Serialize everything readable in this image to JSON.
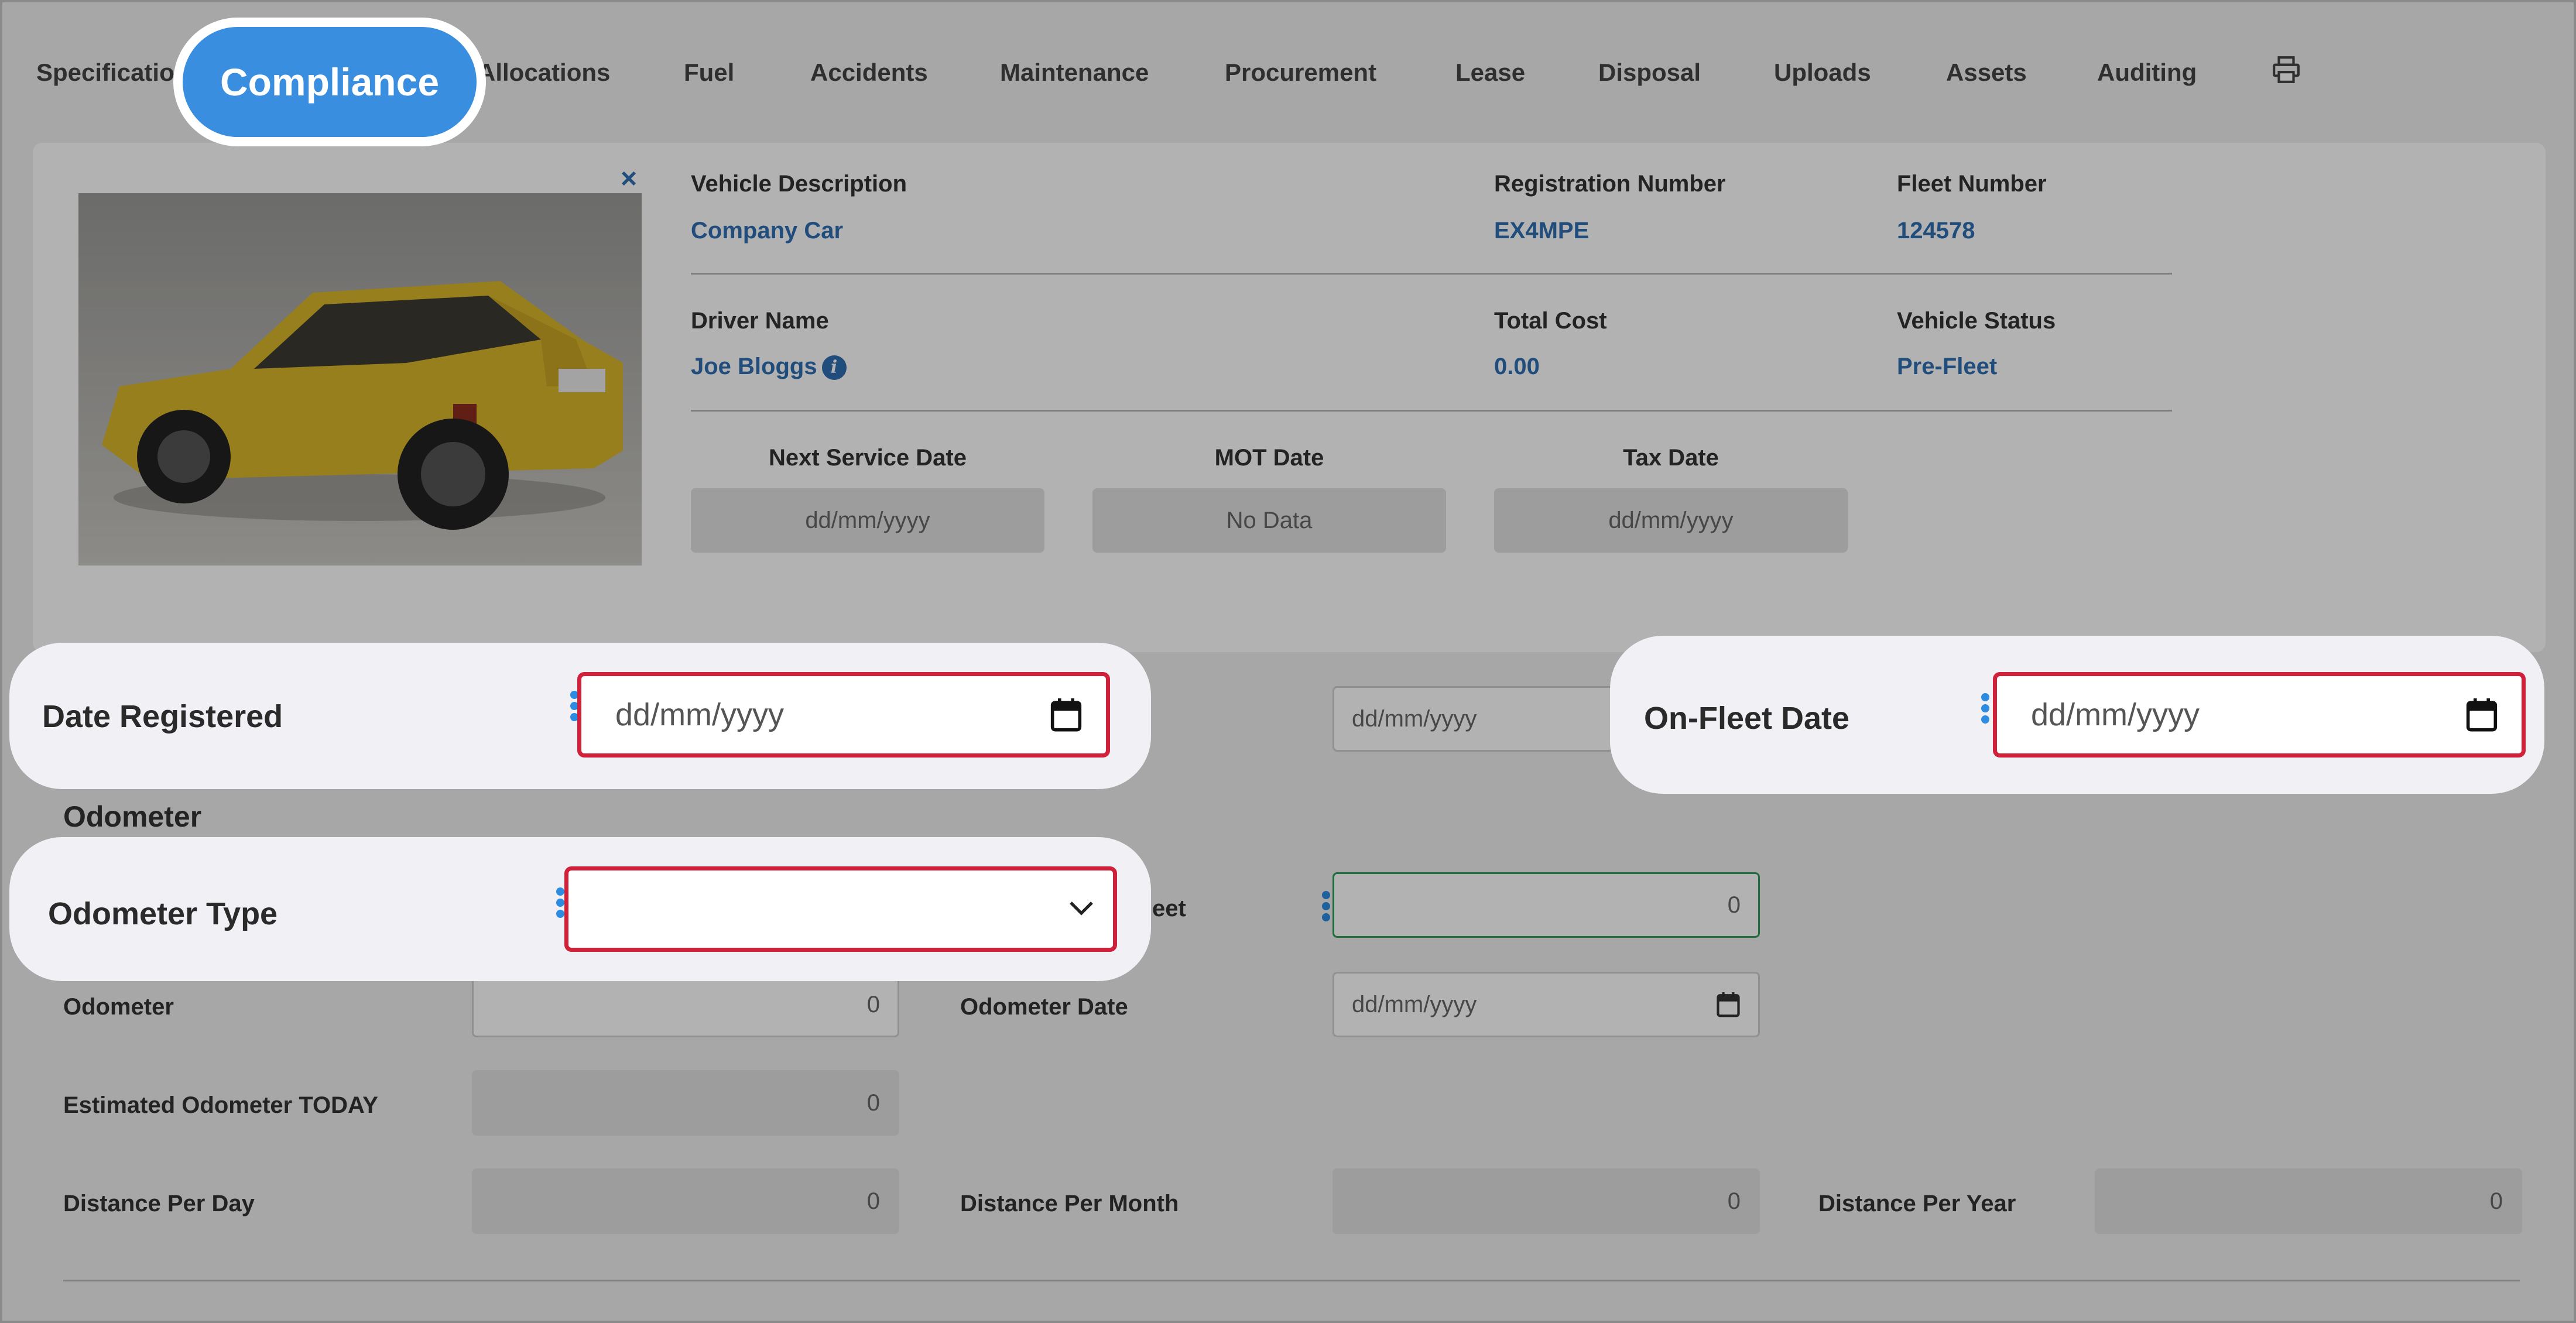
{
  "tabs": [
    {
      "label": "Specifications"
    },
    {
      "label": "Compliance"
    },
    {
      "label": "Allocations"
    },
    {
      "label": "Fuel"
    },
    {
      "label": "Accidents"
    },
    {
      "label": "Maintenance"
    },
    {
      "label": "Procurement"
    },
    {
      "label": "Lease"
    },
    {
      "label": "Disposal"
    },
    {
      "label": "Uploads"
    },
    {
      "label": "Assets"
    },
    {
      "label": "Auditing"
    }
  ],
  "active_tab": "Compliance",
  "toolbar": {
    "print_icon": "print-icon"
  },
  "vehicle": {
    "description_label": "Vehicle Description",
    "description_value": "Company Car",
    "registration_label": "Registration Number",
    "registration_value": "EX4MPE",
    "fleet_label": "Fleet Number",
    "fleet_value": "124578",
    "driver_label": "Driver Name",
    "driver_value": "Joe Bloggs",
    "cost_label": "Total Cost",
    "cost_value": "0.00",
    "status_label": "Vehicle Status",
    "status_value": "Pre-Fleet",
    "close_symbol": "×"
  },
  "dates": {
    "service_label": "Next Service Date",
    "service_value": "dd/mm/yyyy",
    "mot_label": "MOT Date",
    "mot_value": "No Data",
    "tax_label": "Tax Date",
    "tax_value": "dd/mm/yyyy"
  },
  "form": {
    "date_registered_label": "Date Registered",
    "date_registered_placeholder": "dd/mm/yyyy",
    "middle_date_placeholder": "dd/mm/yyyy",
    "onfleet_label": "On-Fleet Date",
    "onfleet_placeholder": "dd/mm/yyyy",
    "odometer_section": "Odometer",
    "odometer_type_label": "Odometer Type",
    "odometer_type_value": "",
    "partial_label": "eet",
    "partial_value": "0",
    "odometer_label": "Odometer",
    "odometer_value": "0",
    "odometer_date_label": "Odometer Date",
    "odometer_date_placeholder": "dd/mm/yyyy",
    "estimated_label": "Estimated Odometer TODAY",
    "estimated_value": "0",
    "per_day_label": "Distance Per Day",
    "per_day_value": "0",
    "per_month_label": "Distance Per Month",
    "per_month_value": "0",
    "per_year_label": "Distance Per Year",
    "per_year_value": "0"
  },
  "colors": {
    "accent": "#3a8ee0",
    "link": "#2f6fb0",
    "error": "#d0203a",
    "valid": "#2e9e5a"
  }
}
